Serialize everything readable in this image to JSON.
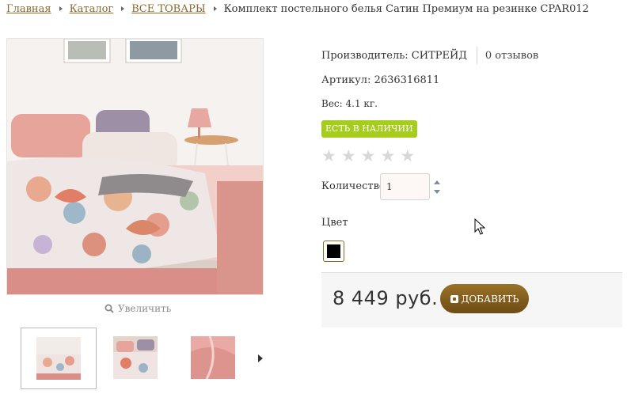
{
  "breadcrumb": {
    "home": "Главная",
    "catalog": "Каталог",
    "all_products": "ВСЕ ТОВАРЫ",
    "current": "Комплект постельного белья Сатин Премиум на резинке CPAR012"
  },
  "gallery": {
    "zoom_label": "Увеличить",
    "zoom_icon": "magnifier-icon",
    "next_icon": "chevron-right-icon"
  },
  "product": {
    "manufacturer": "Производитель: СИТРЕЙД",
    "reviews": "0 отзывов",
    "sku": "Артикул: 2636316811",
    "weight": "Вес: 4.1 кг.",
    "stock_status": "ЕСТЬ В НАЛИЧИИ",
    "stock_color": "#a6cc1e",
    "rating": {
      "value": 0,
      "max": 5
    },
    "quantity_label": "Количество:",
    "quantity_value": "1",
    "color_label": "Цвет",
    "color_swatch": "#000000",
    "price": "8 449 руб.",
    "add_button": "ДОБАВИТЬ",
    "accent_color": "#8a6a2c"
  }
}
